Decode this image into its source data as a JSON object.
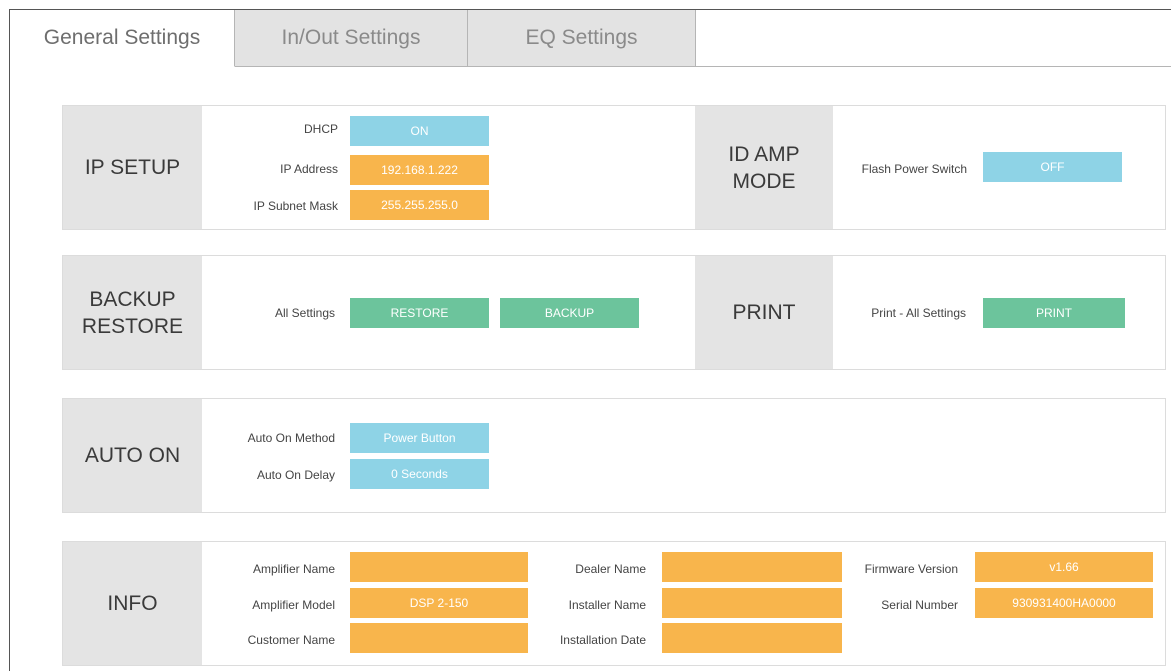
{
  "tabs": [
    {
      "label": "General Settings",
      "active": true
    },
    {
      "label": "In/Out Settings",
      "active": false
    },
    {
      "label": "EQ Settings",
      "active": false
    }
  ],
  "ip_setup": {
    "title": "IP SETUP",
    "dhcp_label": "DHCP",
    "dhcp_value": "ON",
    "ip_label": "IP Address",
    "ip_value": "192.168.1.222",
    "mask_label": "IP Subnet Mask",
    "mask_value": "255.255.255.0"
  },
  "id_amp": {
    "title_line1": "ID AMP",
    "title_line2": "MODE",
    "flash_label": "Flash Power Switch",
    "flash_value": "OFF"
  },
  "backup": {
    "title_line1": "BACKUP",
    "title_line2": "RESTORE",
    "all_label": "All Settings",
    "restore_button": "RESTORE",
    "backup_button": "BACKUP"
  },
  "print": {
    "title": "PRINT",
    "label": "Print - All Settings",
    "button": "PRINT"
  },
  "auto_on": {
    "title": "AUTO ON",
    "method_label": "Auto On Method",
    "method_value": "Power Button",
    "delay_label": "Auto On Delay",
    "delay_value": "0 Seconds"
  },
  "info": {
    "title": "INFO",
    "amp_name_label": "Amplifier Name",
    "amp_name_value": "",
    "amp_model_label": "Amplifier Model",
    "amp_model_value": "DSP 2-150",
    "customer_label": "Customer Name",
    "customer_value": "",
    "dealer_label": "Dealer Name",
    "dealer_value": "",
    "installer_label": "Installer Name",
    "installer_value": "",
    "install_date_label": "Installation Date",
    "install_date_value": "",
    "firmware_label": "Firmware Version",
    "firmware_value": "v1.66",
    "serial_label": "Serial Number",
    "serial_value": "930931400HA0000"
  },
  "colors": {
    "blue": "#8ed3e6",
    "orange": "#f8b54c",
    "green": "#6cc49c",
    "panel_title_bg": "#e4e4e4"
  }
}
